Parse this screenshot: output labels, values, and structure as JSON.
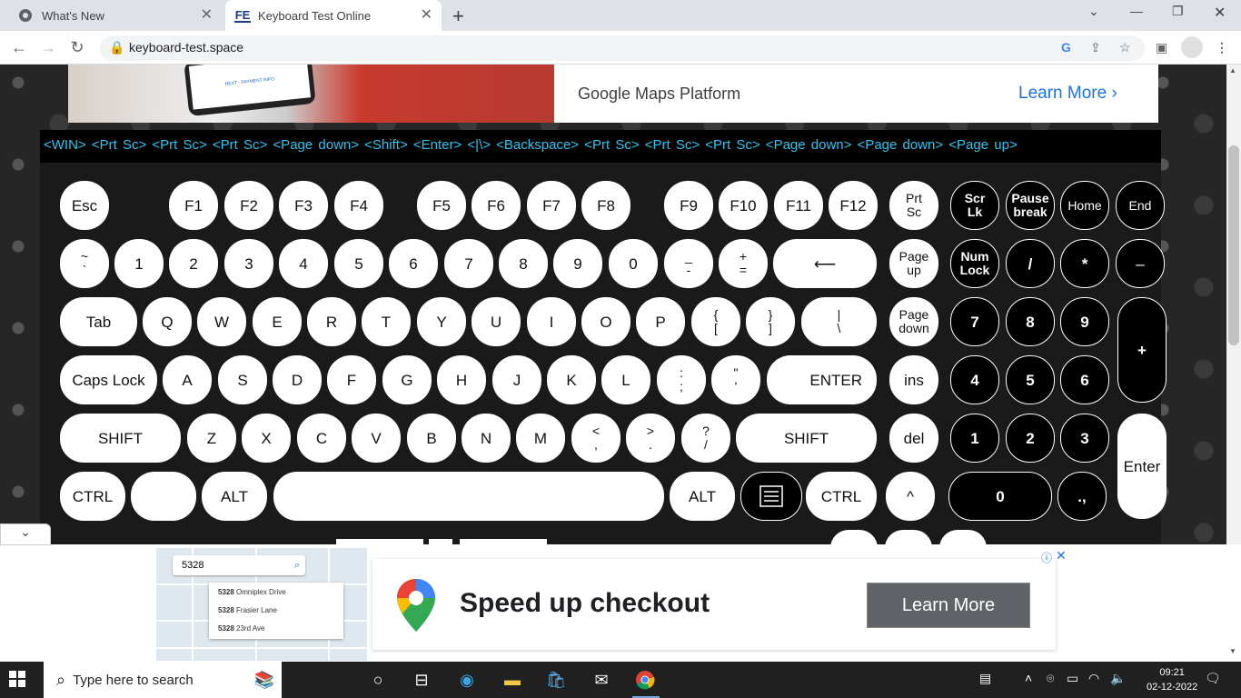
{
  "browser": {
    "tabs": [
      {
        "title": "What's New",
        "active": false
      },
      {
        "title": "Keyboard Test Online",
        "active": true,
        "favicon": "FE"
      }
    ],
    "new_tab": "+",
    "url": "keyboard-test.space"
  },
  "top_ad": {
    "text": "Google Maps Platform",
    "cta": "Learn More",
    "phone_text": "NEXT - PAYMENT INFO"
  },
  "history": {
    "line1": "<WIN>  <Prt Sc>  <Prt Sc>  <Prt Sc>  <Page down>  <Shift>  <Enter>  <|\\>  <Backspace>  <Prt Sc>  <Prt Sc>  <Prt Sc>  <Page down>  <Page down>  <Page up>",
    "line2": ""
  },
  "keyboard": {
    "row1": [
      "Esc",
      "F1",
      "F2",
      "F3",
      "F4",
      "F5",
      "F6",
      "F7",
      "F8",
      "F9",
      "F10",
      "F11",
      "F12"
    ],
    "prtsc": [
      "Prt",
      "Sc"
    ],
    "scrlk": [
      "Scr",
      "Lk"
    ],
    "pause": [
      "Pause",
      "break"
    ],
    "home": "Home",
    "end": "End",
    "row2": [
      [
        "~",
        "`"
      ],
      "1",
      "2",
      "3",
      "4",
      "5",
      "6",
      "7",
      "8",
      "9",
      "0",
      [
        "_",
        "-"
      ],
      [
        "+",
        "="
      ],
      "⟵"
    ],
    "pageup": [
      "Page",
      "up"
    ],
    "numlock": [
      "Num",
      "Lock"
    ],
    "np_div": "/",
    "np_mul": "*",
    "np_minus": "–",
    "row3": [
      "Tab",
      "Q",
      "W",
      "E",
      "R",
      "T",
      "Y",
      "U",
      "I",
      "O",
      "P",
      [
        "{",
        "["
      ],
      [
        "}",
        "]"
      ],
      [
        "|",
        "\\"
      ]
    ],
    "pagedown": [
      "Page",
      "down"
    ],
    "np7": "7",
    "np8": "8",
    "np9": "9",
    "np_plus": "+",
    "row4": [
      "Caps Lock",
      "A",
      "S",
      "D",
      "F",
      "G",
      "H",
      "J",
      "K",
      "L",
      [
        ":",
        ";"
      ],
      [
        "\"",
        "'"
      ],
      "ENTER"
    ],
    "ins": "ins",
    "np4": "4",
    "np5": "5",
    "np6": "6",
    "row5": [
      "SHIFT",
      "Z",
      "X",
      "C",
      "V",
      "B",
      "N",
      "M",
      [
        "<",
        ","
      ],
      [
        ">",
        "."
      ],
      [
        "?",
        "/"
      ],
      "SHIFT"
    ],
    "del": "del",
    "np1": "1",
    "np2": "2",
    "np3": "3",
    "np_enter": "Enter",
    "row6": [
      "CTRL",
      "",
      "ALT",
      "",
      "ALT",
      "",
      "CTRL"
    ],
    "up": "^",
    "np0": "0",
    "np_dot": ".,"
  },
  "bottom_ad": {
    "search_value": "5328",
    "suggestions": [
      {
        "num": "5328",
        "street": "Omniplex Drive"
      },
      {
        "num": "5328",
        "street": "Frasier Lane"
      },
      {
        "num": "5328",
        "street": "23rd Ave"
      }
    ],
    "headline": "Speed up checkout",
    "cta": "Learn More"
  },
  "taskbar": {
    "search_placeholder": "Type here to search",
    "time": "09:21",
    "date": "02-12-2022"
  }
}
